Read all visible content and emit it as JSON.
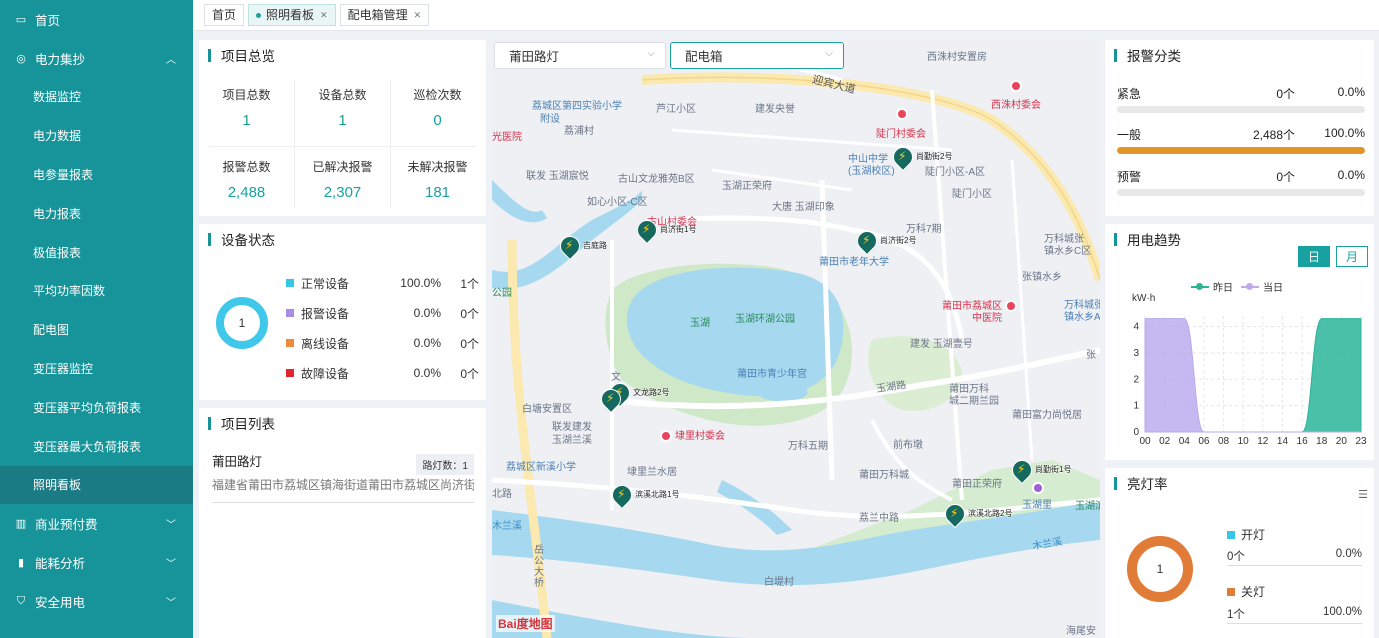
{
  "sidebar": {
    "items": [
      {
        "label": "首页",
        "icon": "monitor-icon",
        "type": "top"
      },
      {
        "label": "电力集抄",
        "icon": "gauge-icon",
        "type": "top-open"
      },
      {
        "label": "数据监控",
        "type": "sub"
      },
      {
        "label": "电力数据",
        "type": "sub"
      },
      {
        "label": "电参量报表",
        "type": "sub"
      },
      {
        "label": "电力报表",
        "type": "sub"
      },
      {
        "label": "极值报表",
        "type": "sub"
      },
      {
        "label": "平均功率因数",
        "type": "sub"
      },
      {
        "label": "配电图",
        "type": "sub"
      },
      {
        "label": "变压器监控",
        "type": "sub"
      },
      {
        "label": "变压器平均负荷报表",
        "type": "sub"
      },
      {
        "label": "变压器最大负荷报表",
        "type": "sub"
      },
      {
        "label": "照明看板",
        "type": "sub-active"
      },
      {
        "label": "商业预付费",
        "icon": "building-icon",
        "type": "top"
      },
      {
        "label": "能耗分析",
        "icon": "bar-chart-icon",
        "type": "top"
      },
      {
        "label": "安全用电",
        "icon": "shield-icon",
        "type": "top"
      }
    ]
  },
  "tabs": [
    {
      "label": "首页"
    },
    {
      "label": "照明看板"
    },
    {
      "label": "配电箱管理"
    }
  ],
  "overview": {
    "title": "项目总览",
    "stats": [
      {
        "label": "项目总数",
        "value": "1"
      },
      {
        "label": "设备总数",
        "value": "1"
      },
      {
        "label": "巡检次数",
        "value": "0"
      },
      {
        "label": "报警总数",
        "value": "2,488"
      },
      {
        "label": "已解决报警",
        "value": "2,307"
      },
      {
        "label": "未解决报警",
        "value": "181"
      }
    ]
  },
  "device_status": {
    "title": "设备状态",
    "donut_center": "1",
    "rows": [
      {
        "name": "正常设备",
        "pct": "100.0%",
        "count": "1个",
        "color": "#36c6e6"
      },
      {
        "name": "报警设备",
        "pct": "0.0%",
        "count": "0个",
        "color": "#a88ce6"
      },
      {
        "name": "离线设备",
        "pct": "0.0%",
        "count": "0个",
        "color": "#f0883e"
      },
      {
        "name": "故障设备",
        "pct": "0.0%",
        "count": "0个",
        "color": "#e0262c"
      }
    ]
  },
  "project_list": {
    "title": "项目列表",
    "item": {
      "name": "莆田路灯",
      "badge": "路灯数：1",
      "address": "福建省莆田市荔城区镇海街道莆田市荔城区尚济街"
    }
  },
  "map": {
    "select_project": "莆田路灯",
    "select_type": "配电箱",
    "pins": [
      {
        "label": "吉庭路"
      },
      {
        "label": "尚济街1号"
      },
      {
        "label": "尚济街2号"
      },
      {
        "label": "尚勤街2号"
      },
      {
        "label": "文龙路2号"
      },
      {
        "label": "滨溪北路1号"
      },
      {
        "label": "尚勤街1号"
      },
      {
        "label": "滨溪北路2号"
      }
    ],
    "labels": {
      "l1": "西洙村安置房",
      "l2": "西洙村委会",
      "l3": "迎宾大道",
      "l4": "荔城区第四实验小学",
      "l5": "附设",
      "l6": "芦江小区",
      "l7": "建发央誉",
      "l8": "陡门村委会",
      "l9": "荔浦村",
      "l10": "光医院",
      "l11": "中山中学",
      "l12": "(玉湖校区)",
      "l13": "尚勤街2号",
      "l14": "陡门小区-A区",
      "l15": "联发 玉湖宸悦",
      "l16": "古山文龙雅苑B区",
      "l17": "玉湖正荣府",
      "l18": "陡门小区",
      "l19": "如心小区-C区",
      "l20": "大唐 玉湖印象",
      "l21": "万科7期",
      "l22": "万科城张",
      "l23": "镇水乡C区",
      "l24": "莆田市老年大学",
      "l25": "张镇水乡",
      "l26": "公园",
      "l27": "玉湖",
      "l28": "玉湖环湖公园",
      "l29": "莆田市荔城区",
      "l30": "中医院",
      "l31": "万科城张",
      "l32": "镇水乡A",
      "l33": "建发 玉湖壹号",
      "l34": "莆田市青少年宫",
      "l35": "玉湖路",
      "l36": "莆田万科",
      "l37": "城二期兰园",
      "l38": "白塘安置区",
      "l39": "联发建发",
      "l40": "玉湖兰溪",
      "l41": "埭里村委会",
      "l42": "万科五期",
      "l43": "前布墩",
      "l44": "莆田富力尚悦居",
      "l45": "荔城区新溪小学",
      "l46": "埭里兰水居",
      "l47": "莆田万科城",
      "l48": "莆田正荣府",
      "l49": "玉湖里",
      "l50": "玉湖滨溪",
      "l51": "北路",
      "l52": "荔兰中路",
      "l53": "木兰溪",
      "l54": "木兰溪",
      "l55": "岳公大桥",
      "l56": "白堤村",
      "l57": "海尾安",
      "l58": "文",
      "l59": "古山村委会",
      "l60": "张"
    },
    "logo": "Bai度地图"
  },
  "alarm_class": {
    "title": "报警分类",
    "rows": [
      {
        "name": "紧急",
        "count": "0个",
        "pct": "0.0%",
        "fraction": 0
      },
      {
        "name": "一般",
        "count": "2,488个",
        "pct": "100.0%",
        "fraction": 1
      },
      {
        "name": "预警",
        "count": "0个",
        "pct": "0.0%",
        "fraction": 0
      }
    ]
  },
  "power_trend": {
    "title": "用电趋势",
    "btn_day": "日",
    "btn_month": "月",
    "legend_yesterday": "昨日",
    "legend_today": "当日",
    "ylabel": "kW·h"
  },
  "chart_data": {
    "type": "area",
    "x": [
      "00",
      "02",
      "04",
      "06",
      "08",
      "10",
      "12",
      "14",
      "16",
      "18",
      "20",
      "23"
    ],
    "yticks": [
      "0",
      "1",
      "2",
      "3",
      "4"
    ],
    "ylim": [
      0,
      4.4
    ],
    "series": [
      {
        "name": "昨日",
        "color": "#2ab59a",
        "values": [
          0,
          0,
          0,
          0,
          0,
          0,
          0,
          0,
          0,
          4.3,
          4.3,
          4.3
        ]
      },
      {
        "name": "当日",
        "color": "#b8a8ee",
        "values": [
          4.3,
          4.3,
          4.3,
          0,
          0,
          0,
          0,
          0,
          0,
          0,
          0,
          0
        ]
      }
    ]
  },
  "light_rate": {
    "title": "亮灯率",
    "donut_center": "1",
    "on_label": "开灯",
    "on_count": "0个",
    "on_pct": "0.0%",
    "off_label": "关灯",
    "off_count": "1个",
    "off_pct": "100.0%"
  }
}
